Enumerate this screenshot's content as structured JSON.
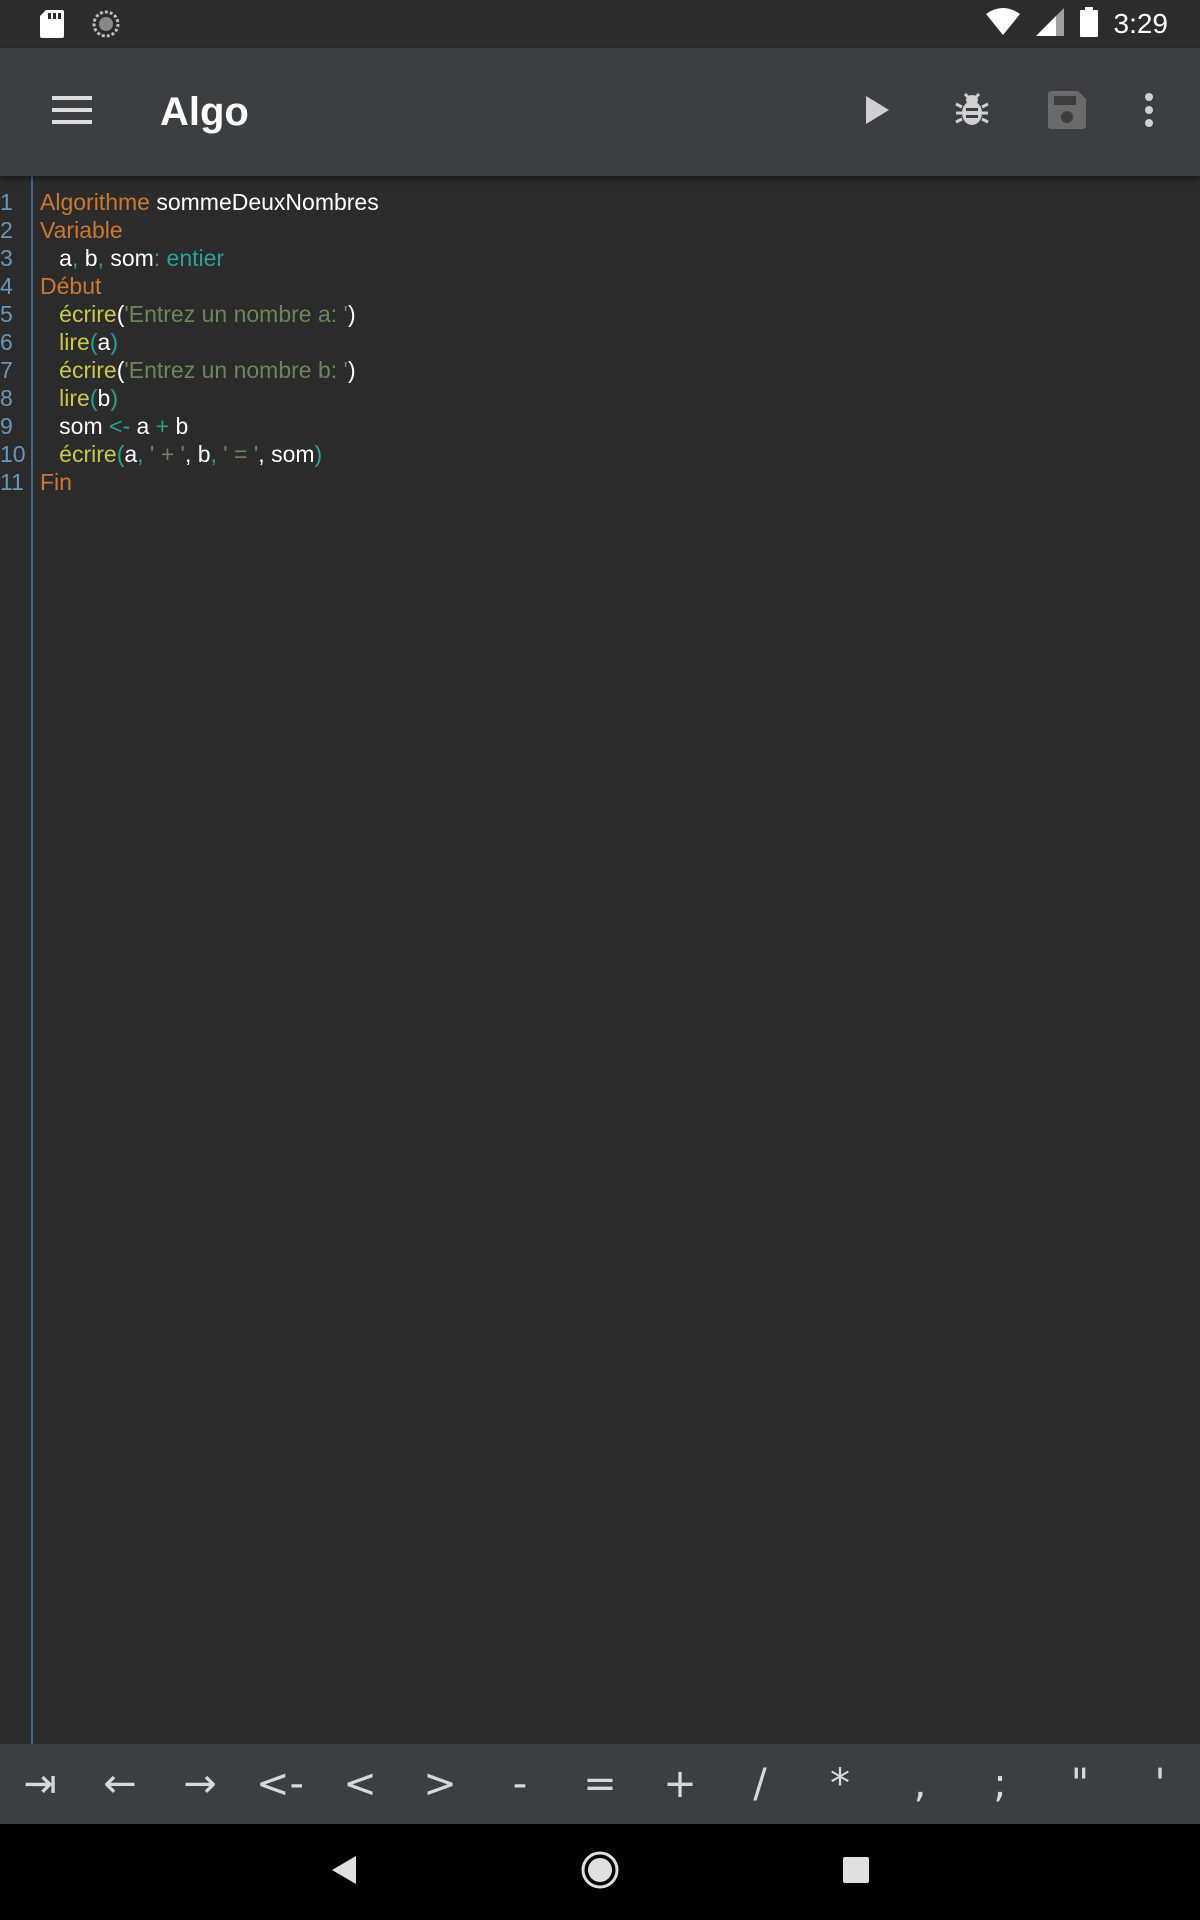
{
  "status_bar": {
    "time": "3:29",
    "left_icons": [
      "sd-card-icon",
      "sync-icon"
    ],
    "right_icons": [
      "wifi-icon",
      "cell-signal-icon",
      "battery-icon"
    ]
  },
  "toolbar": {
    "title": "Algo",
    "actions": [
      "play-icon",
      "bug-icon",
      "save-icon",
      "more-vert-icon"
    ]
  },
  "editor": {
    "lines": [
      {
        "n": "1",
        "tokens": [
          {
            "t": "Algorithme",
            "c": "kw"
          },
          {
            "t": " sommeDeuxNombres",
            "c": "id"
          }
        ]
      },
      {
        "n": "2",
        "tokens": [
          {
            "t": "Variable",
            "c": "kw"
          }
        ]
      },
      {
        "n": "3",
        "tokens": [
          {
            "t": "   a",
            "c": "id"
          },
          {
            "t": ",",
            "c": "op"
          },
          {
            "t": " b",
            "c": "id"
          },
          {
            "t": ",",
            "c": "op"
          },
          {
            "t": " som",
            "c": "id"
          },
          {
            "t": ":",
            "c": "op"
          },
          {
            "t": " entier",
            "c": "typ"
          }
        ]
      },
      {
        "n": "4",
        "tokens": [
          {
            "t": "Début",
            "c": "kw"
          }
        ]
      },
      {
        "n": "5",
        "tokens": [
          {
            "t": "   écrire",
            "c": "fn"
          },
          {
            "t": "(",
            "c": "id"
          },
          {
            "t": "'Entrez un nombre a: '",
            "c": "str"
          },
          {
            "t": ")",
            "c": "id"
          }
        ]
      },
      {
        "n": "6",
        "tokens": [
          {
            "t": "   lire",
            "c": "fn"
          },
          {
            "t": "(",
            "c": "op"
          },
          {
            "t": "a",
            "c": "id"
          },
          {
            "t": ")",
            "c": "op"
          }
        ]
      },
      {
        "n": "7",
        "tokens": [
          {
            "t": "   écrire",
            "c": "fn"
          },
          {
            "t": "(",
            "c": "id"
          },
          {
            "t": "'Entrez un nombre b: '",
            "c": "str"
          },
          {
            "t": ")",
            "c": "id"
          }
        ]
      },
      {
        "n": "8",
        "tokens": [
          {
            "t": "   lire",
            "c": "fn"
          },
          {
            "t": "(",
            "c": "op"
          },
          {
            "t": "b",
            "c": "id"
          },
          {
            "t": ")",
            "c": "op"
          }
        ]
      },
      {
        "n": "9",
        "tokens": [
          {
            "t": "   som",
            "c": "id"
          },
          {
            "t": " <-",
            "c": "op"
          },
          {
            "t": " a",
            "c": "id"
          },
          {
            "t": " +",
            "c": "op"
          },
          {
            "t": " b",
            "c": "id"
          }
        ]
      },
      {
        "n": "10",
        "tokens": [
          {
            "t": "   écrire",
            "c": "fn"
          },
          {
            "t": "(",
            "c": "op"
          },
          {
            "t": "a",
            "c": "id"
          },
          {
            "t": ",",
            "c": "op"
          },
          {
            "t": " ' + '",
            "c": "str"
          },
          {
            "t": ",",
            "c": "id"
          },
          {
            "t": " b",
            "c": "id"
          },
          {
            "t": ",",
            "c": "op"
          },
          {
            "t": " ' = '",
            "c": "str"
          },
          {
            "t": ",",
            "c": "id"
          },
          {
            "t": " som",
            "c": "id"
          },
          {
            "t": ")",
            "c": "op"
          }
        ]
      },
      {
        "n": "11",
        "tokens": [
          {
            "t": "Fin",
            "c": "kw"
          }
        ]
      }
    ]
  },
  "symbols": [
    "⇥",
    "←",
    "→",
    "<-",
    "<",
    ">",
    "-",
    "=",
    "+",
    "/",
    "*",
    ",",
    ";",
    "\"",
    "'"
  ],
  "nav": [
    "back-icon",
    "home-icon",
    "recents-icon"
  ],
  "colors": {
    "keyword": "#cc7832",
    "function": "#c8c84a",
    "string": "#6a8759",
    "type": "#2aa198",
    "line_number": "#6897bb",
    "toolbar": "#3c3f41",
    "editor_bg": "#2b2b2b"
  }
}
